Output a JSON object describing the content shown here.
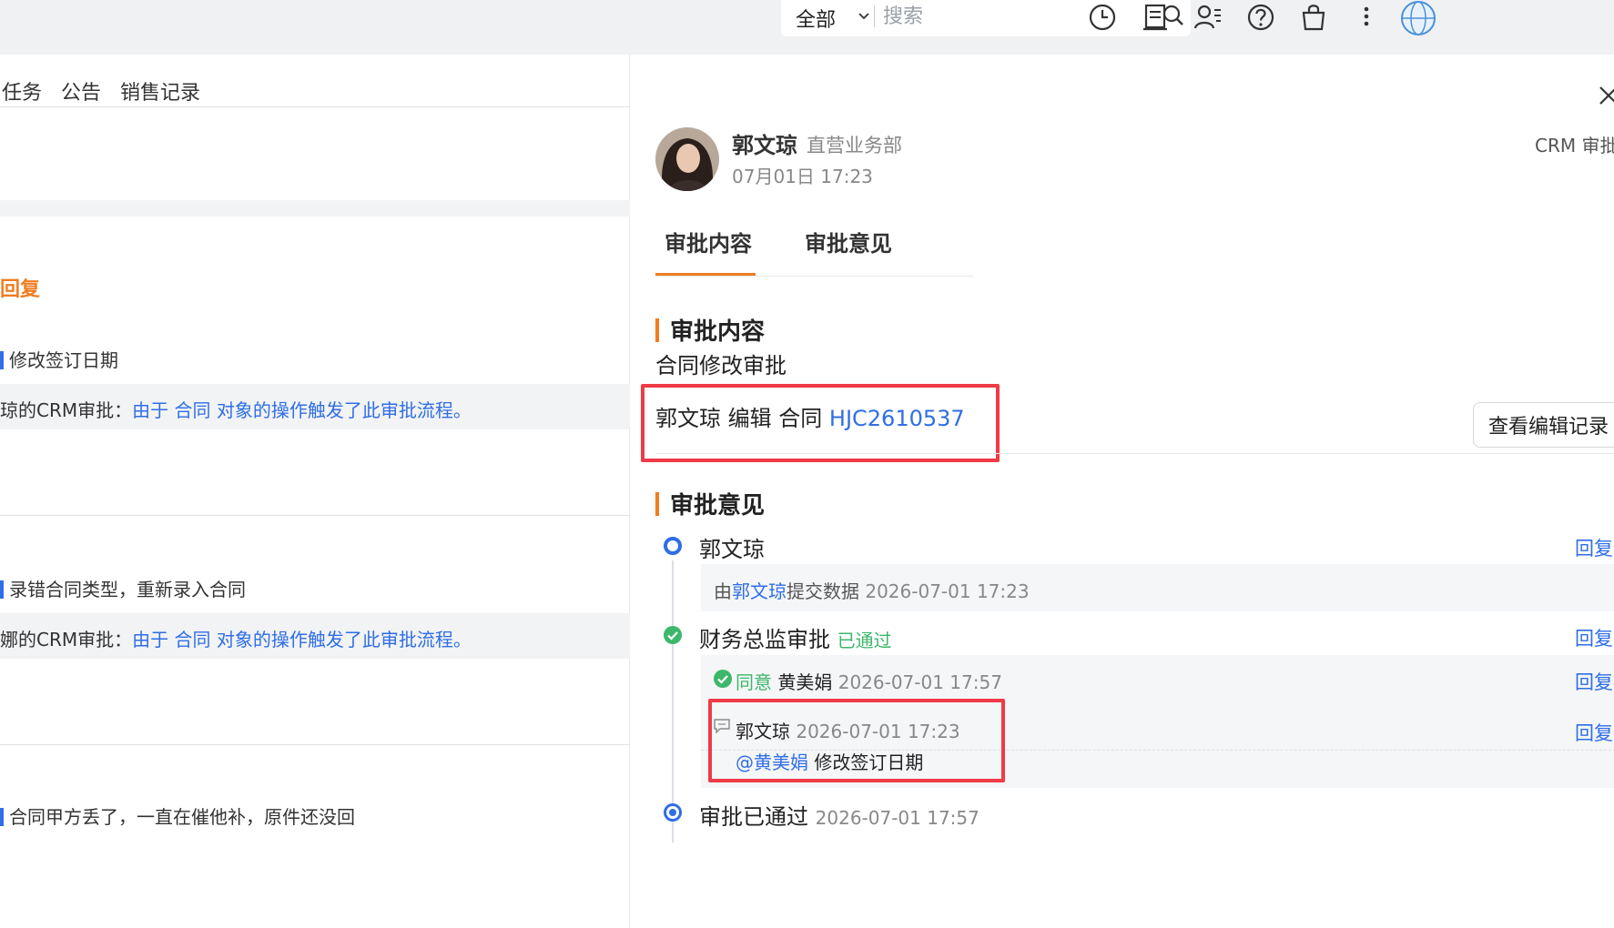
{
  "topbar": {
    "search_scope": "全部",
    "search_placeholder": "搜索",
    "icons": [
      "clock-icon",
      "doc-icon",
      "contacts-icon",
      "help-icon",
      "bag-icon",
      "more-icon",
      "avatar-icon"
    ]
  },
  "left": {
    "tabs": [
      "任务",
      "公告",
      "销售记录"
    ],
    "reply_label": "回复",
    "feed": [
      {
        "comment": "修改签订日期",
        "crm_prefix": "琼的CRM审批：",
        "crm_link": "由于 合同 对象的操作触发了此审批流程。"
      },
      {
        "comment": "录错合同类型，重新录入合同",
        "crm_prefix": "娜的CRM审批：",
        "crm_link": "由于 合同 对象的操作触发了此审批流程。"
      },
      {
        "comment": "合同甲方丢了，一直在催他补，原件还没回"
      }
    ]
  },
  "detail": {
    "user_name": "郭文琼",
    "department": "直营业务部",
    "time": "07月01日 17:23",
    "crm_tag": "CRM 审批",
    "tabs": [
      "审批内容",
      "审批意见"
    ],
    "content_section_title": "审批内容",
    "approval_type": "合同修改审批",
    "edit_prefix": "郭文琼 编辑 合同 ",
    "contract_no": "HJC2610537",
    "edit_record_button": "查看编辑记录",
    "opinion_section_title": "审批意见",
    "timeline": {
      "submitter": "郭文琼",
      "reply": "回复",
      "submit_pre": "由",
      "submit_name": "郭文琼",
      "submit_post": "提交数据",
      "submit_time": "2026-07-01 17:23",
      "step_name": "财务总监审批",
      "step_status": "已通过",
      "agree_label": "同意",
      "approver": "黄美娟",
      "agree_time": "2026-07-01 17:57",
      "comment_author": "郭文琼",
      "comment_time": "2026-07-01 17:23",
      "mention": "@黄美娟",
      "comment_text": " 修改签订日期",
      "final_label": "审批已通过",
      "final_time": "2026-07-01 17:57"
    }
  },
  "colors": {
    "accent_orange": "#ef7d22",
    "link_blue": "#2f6ee6",
    "success_green": "#3db76b",
    "highlight_red": "#ee3b46"
  }
}
